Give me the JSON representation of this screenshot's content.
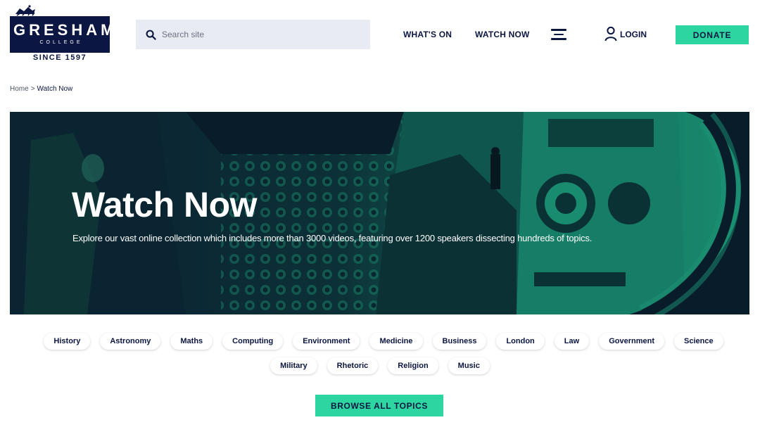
{
  "logo": {
    "name": "GRESHAM",
    "sub": "COLLEGE",
    "since": "SINCE 1597",
    "brand_color": "#0c1642"
  },
  "search": {
    "placeholder": "Search site",
    "icon": "search-icon"
  },
  "nav": {
    "whats_on": "WHAT'S ON",
    "watch_now": "WATCH NOW",
    "menu_icon": "hamburger-icon",
    "login": "LOGIN",
    "login_icon": "user-icon",
    "donate": "DONATE"
  },
  "breadcrumb": {
    "home": "Home",
    "separator": ">",
    "current": "Watch Now"
  },
  "hero": {
    "title": "Watch Now",
    "subtitle": "Explore our vast online collection which includes more than 3000 videos, featuring over 1200 speakers dissecting hundreds of topics."
  },
  "topics": {
    "row1": [
      "History",
      "Astronomy",
      "Maths",
      "Computing",
      "Environment",
      "Medicine",
      "Business",
      "London",
      "Law",
      "Government",
      "Science"
    ],
    "row2": [
      "Military",
      "Rhetoric",
      "Religion",
      "Music"
    ]
  },
  "browse_all": "BROWSE ALL TOPICS",
  "colors": {
    "accent": "#2dd6a0",
    "navy": "#0c1642",
    "search_bg": "#e8ebf2"
  }
}
